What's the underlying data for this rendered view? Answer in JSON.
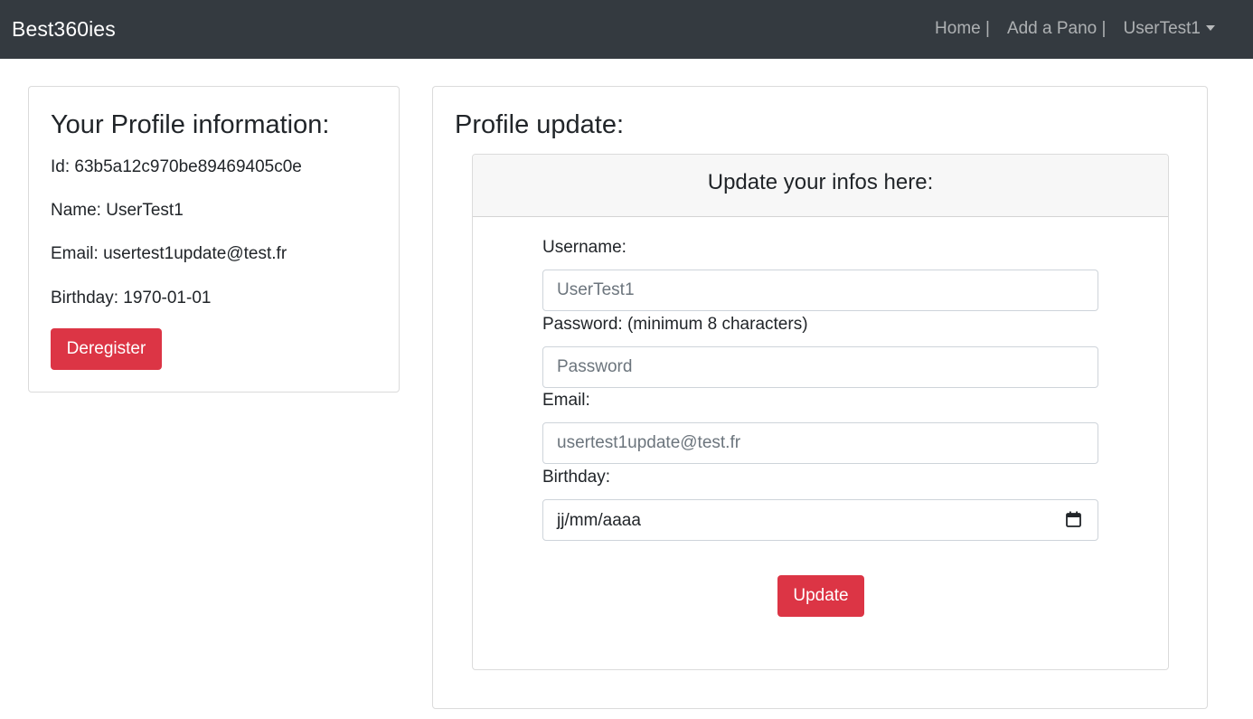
{
  "navbar": {
    "brand": "Best360ies",
    "links": {
      "home": "Home |",
      "add_pano": "Add a Pano |",
      "user": "UserTest1"
    }
  },
  "profile_info": {
    "title": "Your Profile information:",
    "id_label": "Id:",
    "id_value": "63b5a12c970be89469405c0e",
    "name_label": "Name:",
    "name_value": "UserTest1",
    "email_label": "Email:",
    "email_value": "usertest1update@test.fr",
    "birthday_label": "Birthday:",
    "birthday_value": "1970-01-01",
    "deregister_label": "Deregister"
  },
  "profile_update": {
    "title": "Profile update:",
    "form_header": "Update your infos here:",
    "username_label": "Username:",
    "username_placeholder": "UserTest1",
    "password_label": "Password: (minimum 8 characters)",
    "password_placeholder": "Password",
    "email_label": "Email:",
    "email_placeholder": "usertest1update@test.fr",
    "birthday_label": "Birthday:",
    "birthday_placeholder": "jj/mm/aaaa",
    "update_label": "Update"
  },
  "colors": {
    "navbar_bg": "#343a40",
    "danger": "#dc3545",
    "header_bg": "#f7f7f7"
  },
  "icons": {
    "date_picker": "calendar-icon",
    "user_menu": "chevron-down-icon"
  }
}
